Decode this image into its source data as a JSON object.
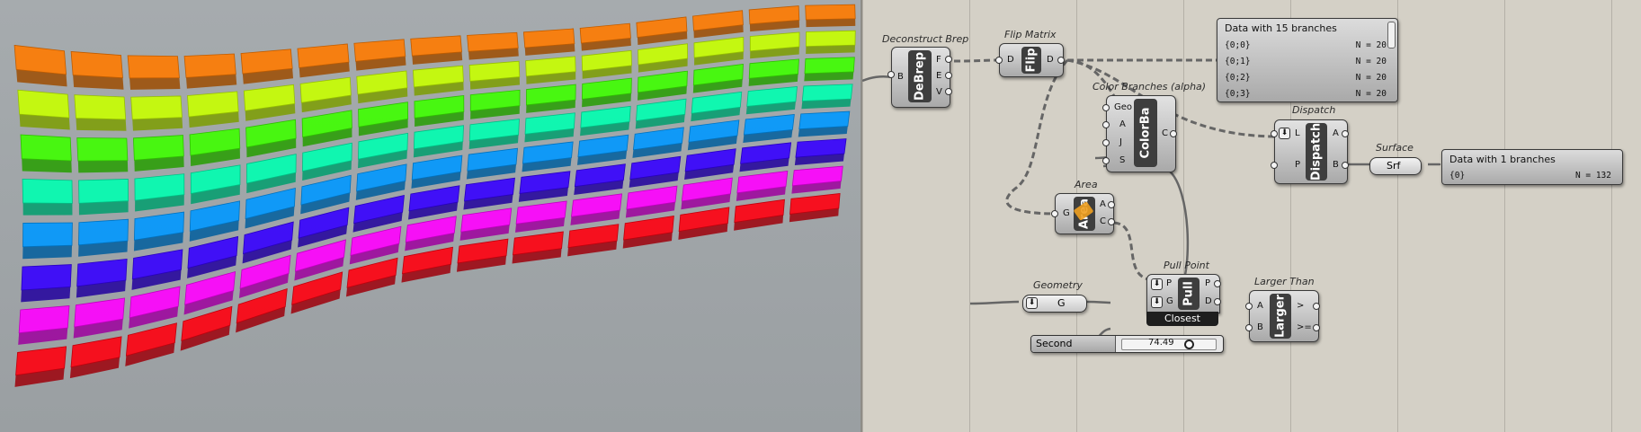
{
  "viewport": {
    "background_top": "#a6abae",
    "background_bottom": "#9a9fa2",
    "band_colors": [
      "#ff7a00",
      "#c8ff00",
      "#3eff00",
      "#00ffb0",
      "#0098ff",
      "#3500ff",
      "#ff00ff",
      "#ff0010"
    ]
  },
  "components": {
    "deconstruct_brep": {
      "title": "Deconstruct Brep",
      "core": "DeBrep",
      "inputs": [
        "B"
      ],
      "outputs": [
        "F",
        "E",
        "V"
      ]
    },
    "flip_matrix": {
      "title": "Flip Matrix",
      "core": "Flip",
      "inputs": [
        "D"
      ],
      "outputs": [
        "D"
      ]
    },
    "color_branches": {
      "title": "Color Branches (alpha)",
      "core": "ColorBa",
      "inputs": [
        "Geo",
        "A",
        "J",
        "S"
      ],
      "outputs": [
        "C"
      ]
    },
    "area": {
      "title": "Area",
      "core": "Area",
      "inputs": [
        "G"
      ],
      "outputs": [
        "A",
        "C"
      ]
    },
    "dispatch": {
      "title": "Dispatch",
      "core": "Dispatch",
      "inputs": [
        "L",
        "P"
      ],
      "outputs": [
        "A",
        "B"
      ]
    },
    "surface": {
      "title": "Surface",
      "label": "Srf"
    },
    "pull_point": {
      "title": "Pull Point",
      "core": "Pull",
      "inputs": [
        "P",
        "G"
      ],
      "outputs": [
        "P",
        "D"
      ],
      "footer": "Closest"
    },
    "geometry": {
      "title": "Geometry",
      "label": "G"
    },
    "larger_than": {
      "title": "Larger Than",
      "core": "Larger",
      "inputs": [
        "A",
        "B"
      ],
      "outputs": [
        ">",
        ">="
      ]
    },
    "second_number": {
      "label": "Second Number",
      "value": "74.49"
    }
  },
  "panels": {
    "top": {
      "header": "Data with 15 branches",
      "rows": [
        {
          "path": "{0;0}",
          "n": "N = 20"
        },
        {
          "path": "{0;1}",
          "n": "N = 20"
        },
        {
          "path": "{0;2}",
          "n": "N = 20"
        },
        {
          "path": "{0;3}",
          "n": "N = 20"
        }
      ]
    },
    "bottom": {
      "header": "Data with 1 branches",
      "rows": [
        {
          "path": "{0}",
          "n": "N = 132"
        }
      ]
    }
  },
  "colors": {
    "component_core": "#3e3e3e",
    "canvas": "#d4d0c6",
    "wire": "#777777"
  }
}
